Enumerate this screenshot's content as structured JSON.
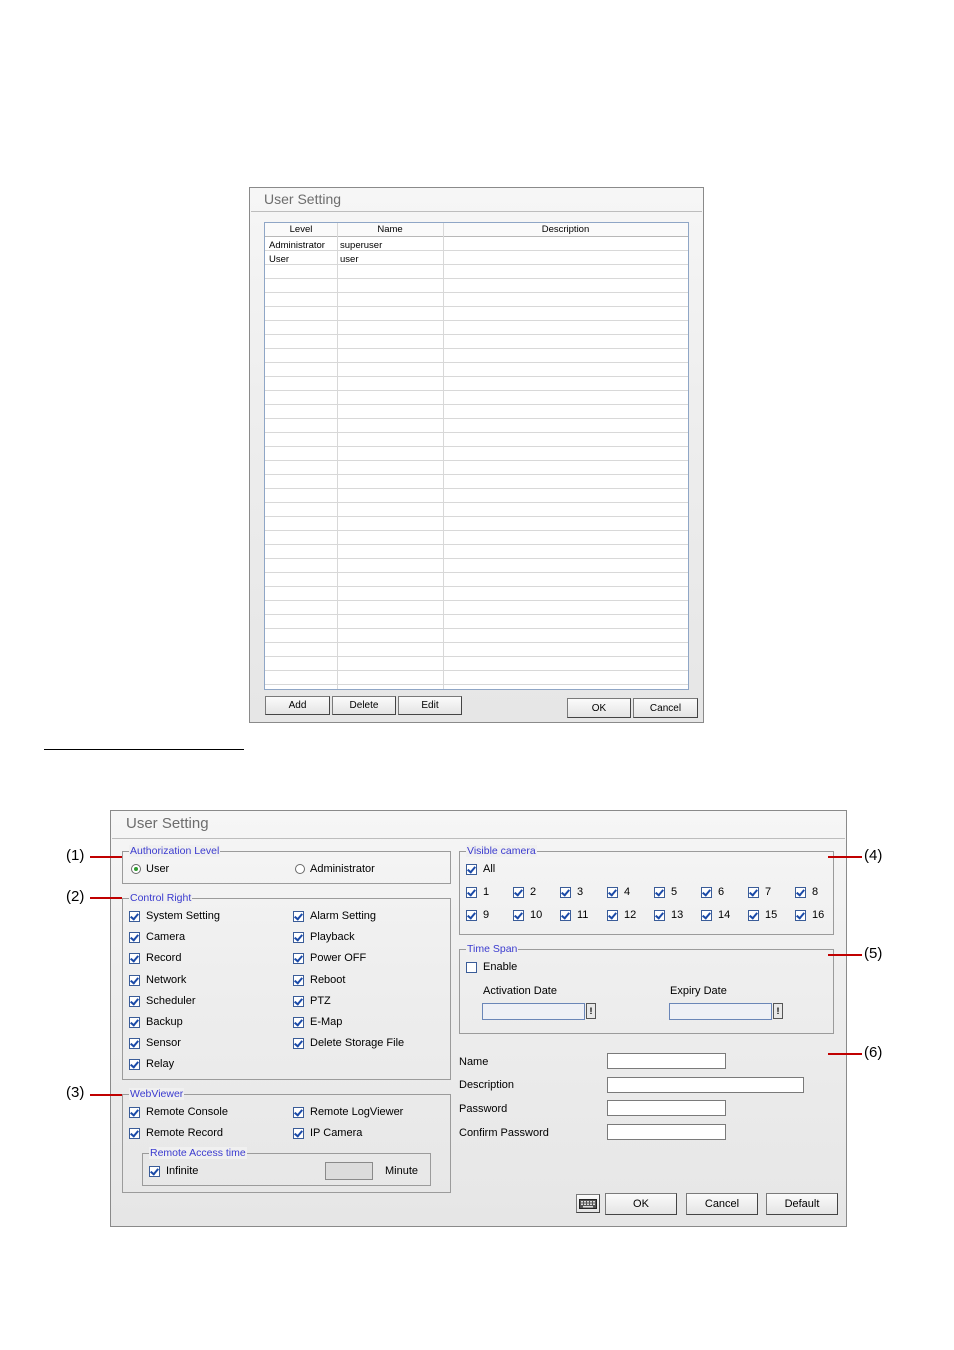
{
  "dialog1": {
    "title": "User Setting",
    "columns": [
      "Level",
      "Name",
      "Description"
    ],
    "rows": [
      {
        "level": "Administrator",
        "name": "superuser",
        "description": ""
      },
      {
        "level": "User",
        "name": "user",
        "description": ""
      }
    ],
    "buttons": {
      "add": "Add",
      "delete": "Delete",
      "edit": "Edit",
      "ok": "OK",
      "cancel": "Cancel"
    }
  },
  "dialog2": {
    "title": "User Setting",
    "auth": {
      "title": "Authorization Level",
      "user": "User",
      "admin": "Administrator",
      "selected": "User"
    },
    "control": {
      "title": "Control Right",
      "left": [
        "System Setting",
        "Camera",
        "Record",
        "Network",
        "Scheduler",
        "Backup",
        "Sensor",
        "Relay"
      ],
      "right": [
        "Alarm Setting",
        "Playback",
        "Power OFF",
        "Reboot",
        "PTZ",
        "E-Map",
        "Delete Storage File"
      ]
    },
    "webviewer": {
      "title": "WebViewer",
      "items": [
        "Remote Console",
        "Remote LogViewer",
        "Remote Record",
        "IP Camera"
      ],
      "remote_access": {
        "title": "Remote Access time",
        "infinite": "Infinite",
        "minute": "Minute",
        "value": ""
      }
    },
    "visible": {
      "title": "Visible camera",
      "all": "All",
      "cameras": [
        "1",
        "2",
        "3",
        "4",
        "5",
        "6",
        "7",
        "8",
        "9",
        "10",
        "11",
        "12",
        "13",
        "14",
        "15",
        "16"
      ]
    },
    "timespan": {
      "title": "Time Span",
      "enable": "Enable",
      "activation": "Activation Date",
      "expiry": "Expiry Date",
      "date_btn": "!"
    },
    "fields": {
      "name": "Name",
      "description": "Description",
      "password": "Password",
      "confirm": "Confirm Password"
    },
    "buttons": {
      "ok": "OK",
      "cancel": "Cancel",
      "default": "Default"
    }
  },
  "markers": {
    "m1": "(1)",
    "m2": "(2)",
    "m3": "(3)",
    "m4": "(4)",
    "m5": "(5)",
    "m6": "(6)"
  }
}
